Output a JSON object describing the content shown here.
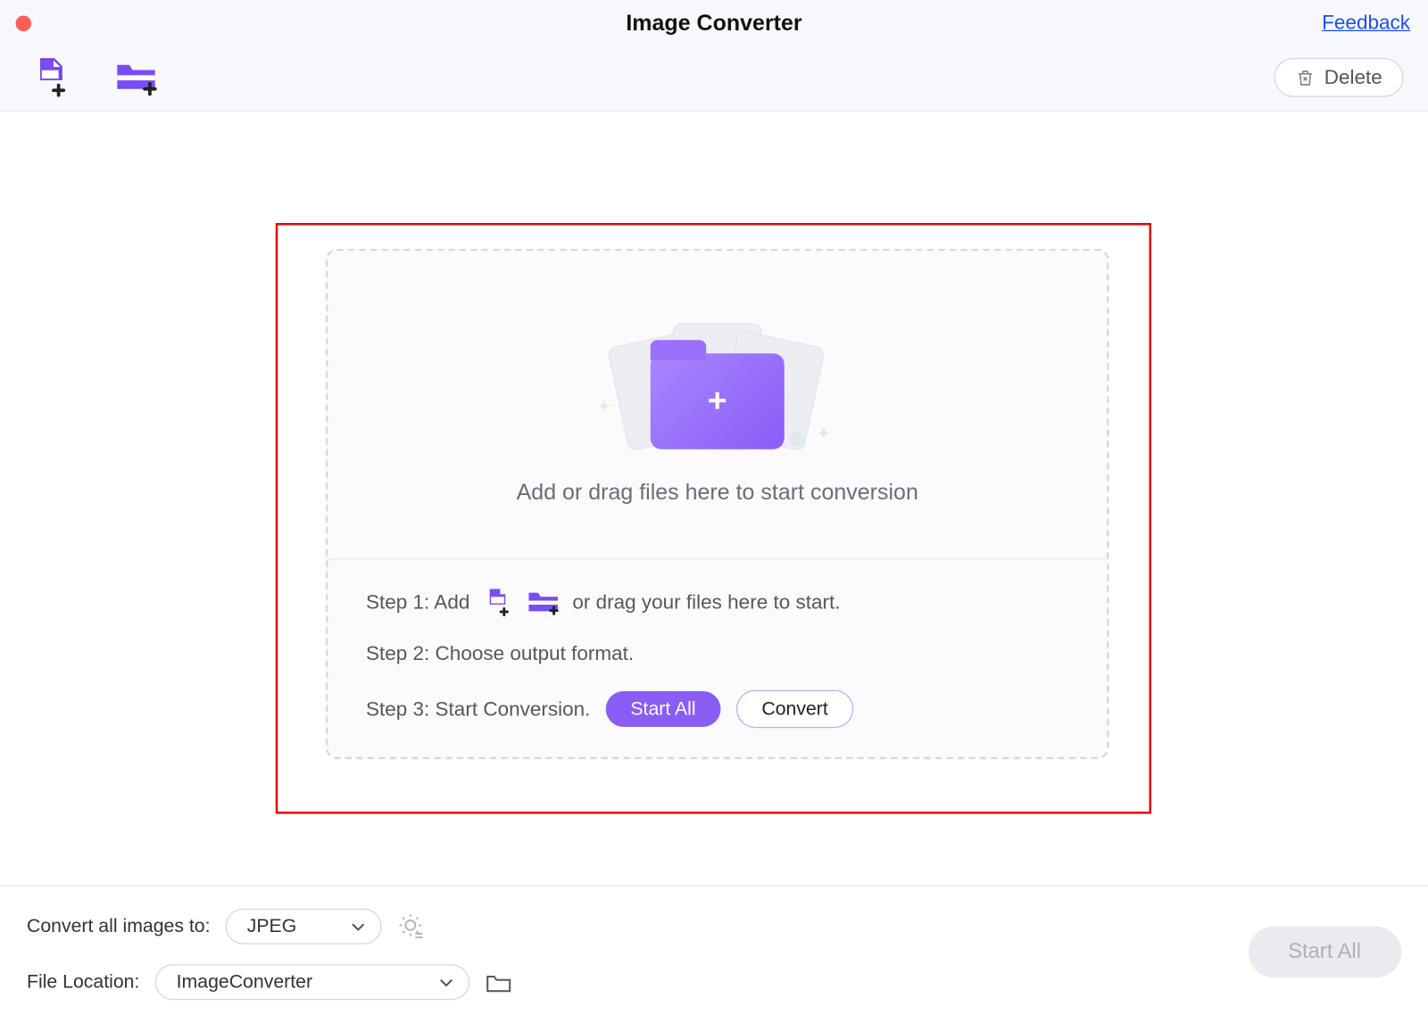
{
  "header": {
    "title": "Image Converter",
    "feedback": "Feedback",
    "delete_label": "Delete"
  },
  "dropzone": {
    "prompt": "Add or drag files here to start conversion",
    "step1_prefix": "Step 1: Add",
    "step1_suffix": "or drag your files here to start.",
    "step2": "Step 2: Choose output format.",
    "step3_prefix": "Step 3: Start Conversion.",
    "start_all_label": "Start  All",
    "convert_label": "Convert"
  },
  "footer": {
    "convert_label": "Convert all images to:",
    "format_value": "JPEG",
    "location_label": "File Location:",
    "location_value": "ImageConverter",
    "start_all": "Start  All"
  },
  "colors": {
    "accent": "#8a5cf6"
  }
}
